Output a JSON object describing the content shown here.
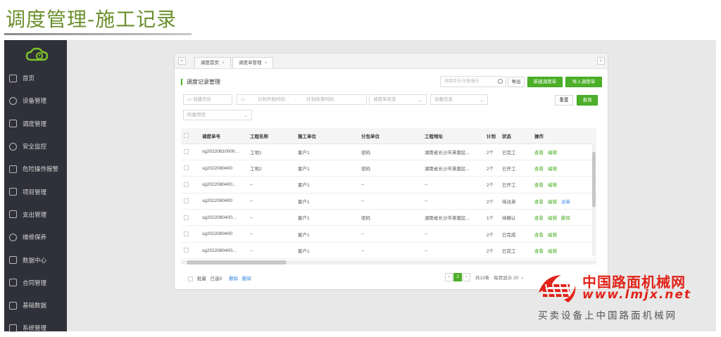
{
  "slide": {
    "title": "调度管理-施工记录"
  },
  "sidebar": {
    "items": [
      {
        "label": "首页",
        "icon": "home-icon"
      },
      {
        "label": "设备管理",
        "icon": "device-icon"
      },
      {
        "label": "调度管理",
        "icon": "dispatch-icon"
      },
      {
        "label": "安全监控",
        "icon": "monitor-icon"
      },
      {
        "label": "危险操作报警",
        "icon": "alarm-icon"
      },
      {
        "label": "项目管理",
        "icon": "project-icon"
      },
      {
        "label": "支出管理",
        "icon": "expense-icon"
      },
      {
        "label": "维修保养",
        "icon": "repair-icon"
      },
      {
        "label": "数据中心",
        "icon": "data-center-icon"
      },
      {
        "label": "合同管理",
        "icon": "contract-icon"
      },
      {
        "label": "基础数据",
        "icon": "base-data-icon"
      },
      {
        "label": "系统管理",
        "icon": "system-icon"
      }
    ]
  },
  "tabs": [
    {
      "label": "调度首页"
    },
    {
      "label": "调度单管理"
    }
  ],
  "toolbar": {
    "section_title": "调度记录管理",
    "search_placeholder": "调度单号/设备编号",
    "export_label": "导出",
    "new_label": "新建调度单",
    "import_label": "导入调度单",
    "reset_label": "重置",
    "query_label": "查询"
  },
  "filters": {
    "created_month": "创建月份",
    "plan_start": "计划开始时间",
    "plan_end": "计划结束时间",
    "status": "调度单状态",
    "device": "设备信息",
    "project": "所属项目"
  },
  "table": {
    "columns": [
      "调度单号",
      "工程名称",
      "施工单位",
      "分包单位",
      "工程地址",
      "计划",
      "状态",
      "操作"
    ],
    "rows": [
      {
        "no": "sg20220810000...",
        "name": "工地1",
        "unit": "客户1",
        "sub": "密码",
        "addr": "湖南省长沙市芙蓉区...",
        "plan": "2个",
        "status": "已完工",
        "actions": [
          "查看",
          "编辑"
        ]
      },
      {
        "no": "sg2022080400",
        "name": "工地2",
        "unit": "客户1",
        "sub": "密码",
        "addr": "湖南省长沙市芙蓉区...",
        "plan": "2个",
        "status": "已开工",
        "actions": [
          "查看",
          "编辑"
        ]
      },
      {
        "no": "sg2022080400...",
        "name": "--",
        "unit": "客户1",
        "sub": "--",
        "addr": "--",
        "plan": "2个",
        "status": "已开工",
        "actions": [
          "查看",
          "编辑"
        ]
      },
      {
        "no": "sg2022080400",
        "name": "--",
        "unit": "客户1",
        "sub": "--",
        "addr": "--",
        "plan": "2个",
        "status": "待派单",
        "actions": [
          "查看",
          "编辑",
          "派单"
        ]
      },
      {
        "no": "sg2022080400...",
        "name": "--",
        "unit": "客户1",
        "sub": "密码",
        "addr": "湖南省长沙市芙蓉区...",
        "plan": "1个",
        "status": "待确认",
        "actions": [
          "查看",
          "编辑",
          "删除"
        ]
      },
      {
        "no": "sg2022080400",
        "name": "--",
        "unit": "客户1",
        "sub": "--",
        "addr": "--",
        "plan": "2个",
        "status": "已完成",
        "actions": [
          "查看",
          "编辑"
        ]
      },
      {
        "no": "sg2022080400...",
        "name": "--",
        "unit": "客户1",
        "sub": "--",
        "addr": "--",
        "plan": "2个",
        "status": "已完工",
        "actions": [
          "查看",
          "编辑"
        ]
      }
    ]
  },
  "footer": {
    "batch_label": "批量",
    "selected_label": "已选0",
    "delete_label": "删除",
    "delete2_label": "删除",
    "current_page": "1",
    "total_label": "共13条",
    "per_page_label": "每页显示 20"
  },
  "watermark": {
    "cn_name": "中国路面机械网",
    "url": "www.lmjx.net",
    "slogan": "买卖设备上中国路面机械网"
  },
  "colors": {
    "accent": "#4caf28",
    "sidebar": "#2f3039",
    "title": "#6a8f2c",
    "watermark": "#e2231a"
  }
}
